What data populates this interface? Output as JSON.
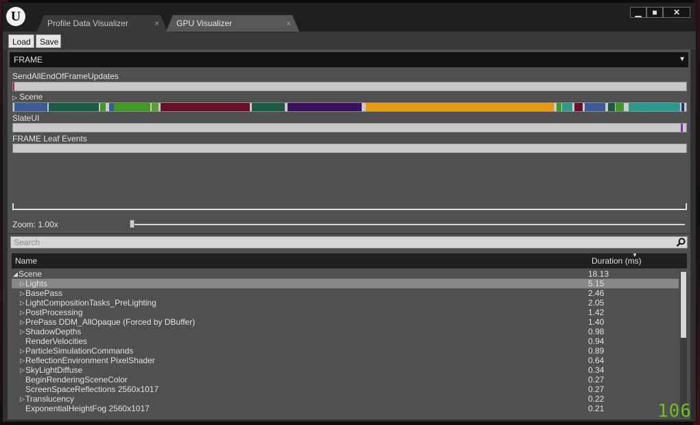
{
  "window": {
    "logo_text": "U",
    "tabs": [
      {
        "label": "Profile Data Visualizer",
        "close": "×"
      },
      {
        "label": "GPU Visualizer",
        "close": "×"
      }
    ],
    "controls": {
      "minimize": "▁",
      "maximize": "■",
      "close": "✕"
    }
  },
  "toolbar": {
    "load_label": "Load",
    "save_label": "Save"
  },
  "frame_dropdown": {
    "selected": "FRAME",
    "arrow": "▼"
  },
  "tracks": {
    "send_all": {
      "label": "SendAllEndOfFrameUpdates"
    },
    "scene": {
      "label": "Scene",
      "expand": "▷"
    },
    "slate": {
      "label": "SlateUI"
    },
    "leaf": {
      "label": "FRAME Leaf Events"
    }
  },
  "scene_bar_colors": {
    "blue": "#3a5a9a",
    "dark_teal": "#1c5a48",
    "green": "#3e9a20",
    "crimson": "#6a1028",
    "purple": "#3a1060",
    "orange": "#e89a10",
    "teal": "#2a9a8a",
    "navy": "#1c3a7a"
  },
  "zoom": {
    "label": "Zoom: 1.00x",
    "value": 1.0
  },
  "search": {
    "placeholder": "Search"
  },
  "list_header": {
    "name": "Name",
    "duration": "Duration (ms)",
    "sort_arrow": "▼"
  },
  "rows": [
    {
      "name": "Scene",
      "duration": "18.13",
      "arrow": "◢"
    },
    {
      "name": "Lights",
      "duration": "5.15",
      "arrow": "▷"
    },
    {
      "name": "BasePass",
      "duration": "2.46",
      "arrow": "▷"
    },
    {
      "name": "LightCompositionTasks_PreLighting",
      "duration": "2.05",
      "arrow": "▷"
    },
    {
      "name": "PostProcessing",
      "duration": "1.42",
      "arrow": "▷"
    },
    {
      "name": "PrePass DDM_AllOpaque (Forced by DBuffer)",
      "duration": "1.40",
      "arrow": "▷"
    },
    {
      "name": "ShadowDepths",
      "duration": "0.98",
      "arrow": "▷"
    },
    {
      "name": "RenderVelocities",
      "duration": "0.94",
      "arrow": ""
    },
    {
      "name": "ParticleSimulationCommands",
      "duration": "0.89",
      "arrow": "▷"
    },
    {
      "name": "ReflectionEnvironment PixelShader",
      "duration": "0.64",
      "arrow": "▷"
    },
    {
      "name": "SkyLightDiffuse",
      "duration": "0.34",
      "arrow": "▷"
    },
    {
      "name": "BeginRenderingSceneColor",
      "duration": "0.27",
      "arrow": ""
    },
    {
      "name": "ScreenSpaceReflections 2560x1017",
      "duration": "0.27",
      "arrow": ""
    },
    {
      "name": "Translucency",
      "duration": "0.22",
      "arrow": "▷"
    },
    {
      "name": "ExponentialHeightFog 2560x1017",
      "duration": "0.21",
      "arrow": ""
    }
  ],
  "selected_row": "Lights",
  "fps_counter": "106"
}
